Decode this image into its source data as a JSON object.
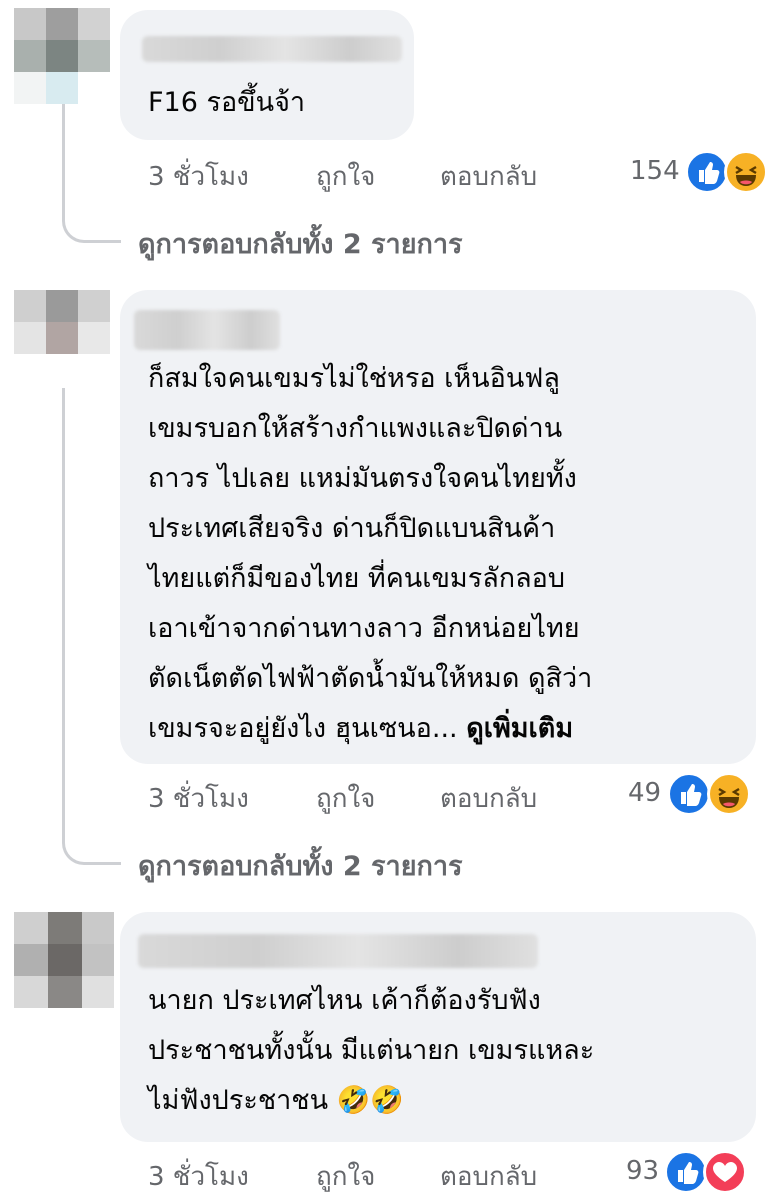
{
  "comments": [
    {
      "text_lines": [
        "F16 รอขึ้นจ้า"
      ],
      "actions": {
        "time": "3 ชั่วโมง",
        "like": "ถูกใจ",
        "reply": "ตอบกลับ"
      },
      "reaction_count": "154",
      "reactions": [
        "like-icon",
        "haha-icon"
      ],
      "view_replies": "ดูการตอบกลับทั้ง 2 รายการ"
    },
    {
      "text_lines": [
        "ก็สมใจคนเขมรไม่ใช่หรอ เห็นอินฟลู",
        "เขมรบอกให้สร้างกำแพงและปิดด่าน",
        "ถาวร ไปเลย แหม่มันตรงใจคนไทยทั้ง",
        "ประเทศเสียจริง ด่านก็ปิดแบนสินค้า",
        "ไทยแต่ก็มีของไทย ที่คนเขมรลักลอบ",
        "เอาเข้าจากด่านทางลาว อีกหน่อยไทย",
        "ตัดเน็ตตัดไฟฟ้าตัดน้ำมันให้หมด ดูสิว่า",
        "เขมรจะอยู่ยังไง ฮุนเซนอ..."
      ],
      "see_more": "ดูเพิ่มเติม",
      "actions": {
        "time": "3 ชั่วโมง",
        "like": "ถูกใจ",
        "reply": "ตอบกลับ"
      },
      "reaction_count": "49",
      "reactions": [
        "like-icon",
        "haha-icon"
      ],
      "view_replies": "ดูการตอบกลับทั้ง 2 รายการ"
    },
    {
      "text_lines": [
        "นายก ประเทศไหน เค้าก็ต้องรับฟัง",
        "ประชาชนทั้งนั้น มีแต่นายก เขมรแหละ",
        "ไม่ฟังประชาชน"
      ],
      "emoji": "🤣🤣",
      "actions": {
        "time": "3 ชั่วโมง",
        "like": "ถูกใจ",
        "reply": "ตอบกลับ"
      },
      "reaction_count": "93",
      "reactions": [
        "like-icon",
        "love-icon"
      ]
    }
  ],
  "colors": {
    "bubble": "#f0f2f5",
    "meta": "#65676b",
    "like": "#1b74e4",
    "haha": "#f7b125",
    "love": "#f33e58"
  }
}
